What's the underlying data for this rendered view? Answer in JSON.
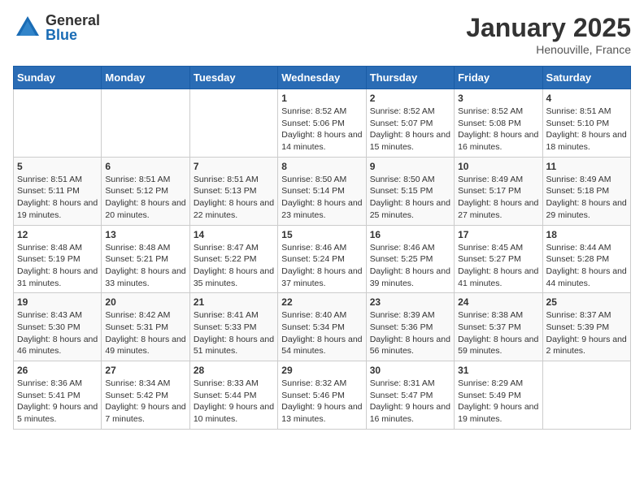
{
  "header": {
    "logo_general": "General",
    "logo_blue": "Blue",
    "month_title": "January 2025",
    "location": "Henouville, France"
  },
  "days_of_week": [
    "Sunday",
    "Monday",
    "Tuesday",
    "Wednesday",
    "Thursday",
    "Friday",
    "Saturday"
  ],
  "weeks": [
    [
      {
        "day": "",
        "info": ""
      },
      {
        "day": "",
        "info": ""
      },
      {
        "day": "",
        "info": ""
      },
      {
        "day": "1",
        "info": "Sunrise: 8:52 AM\nSunset: 5:06 PM\nDaylight: 8 hours\nand 14 minutes."
      },
      {
        "day": "2",
        "info": "Sunrise: 8:52 AM\nSunset: 5:07 PM\nDaylight: 8 hours\nand 15 minutes."
      },
      {
        "day": "3",
        "info": "Sunrise: 8:52 AM\nSunset: 5:08 PM\nDaylight: 8 hours\nand 16 minutes."
      },
      {
        "day": "4",
        "info": "Sunrise: 8:51 AM\nSunset: 5:10 PM\nDaylight: 8 hours\nand 18 minutes."
      }
    ],
    [
      {
        "day": "5",
        "info": "Sunrise: 8:51 AM\nSunset: 5:11 PM\nDaylight: 8 hours\nand 19 minutes."
      },
      {
        "day": "6",
        "info": "Sunrise: 8:51 AM\nSunset: 5:12 PM\nDaylight: 8 hours\nand 20 minutes."
      },
      {
        "day": "7",
        "info": "Sunrise: 8:51 AM\nSunset: 5:13 PM\nDaylight: 8 hours\nand 22 minutes."
      },
      {
        "day": "8",
        "info": "Sunrise: 8:50 AM\nSunset: 5:14 PM\nDaylight: 8 hours\nand 23 minutes."
      },
      {
        "day": "9",
        "info": "Sunrise: 8:50 AM\nSunset: 5:15 PM\nDaylight: 8 hours\nand 25 minutes."
      },
      {
        "day": "10",
        "info": "Sunrise: 8:49 AM\nSunset: 5:17 PM\nDaylight: 8 hours\nand 27 minutes."
      },
      {
        "day": "11",
        "info": "Sunrise: 8:49 AM\nSunset: 5:18 PM\nDaylight: 8 hours\nand 29 minutes."
      }
    ],
    [
      {
        "day": "12",
        "info": "Sunrise: 8:48 AM\nSunset: 5:19 PM\nDaylight: 8 hours\nand 31 minutes."
      },
      {
        "day": "13",
        "info": "Sunrise: 8:48 AM\nSunset: 5:21 PM\nDaylight: 8 hours\nand 33 minutes."
      },
      {
        "day": "14",
        "info": "Sunrise: 8:47 AM\nSunset: 5:22 PM\nDaylight: 8 hours\nand 35 minutes."
      },
      {
        "day": "15",
        "info": "Sunrise: 8:46 AM\nSunset: 5:24 PM\nDaylight: 8 hours\nand 37 minutes."
      },
      {
        "day": "16",
        "info": "Sunrise: 8:46 AM\nSunset: 5:25 PM\nDaylight: 8 hours\nand 39 minutes."
      },
      {
        "day": "17",
        "info": "Sunrise: 8:45 AM\nSunset: 5:27 PM\nDaylight: 8 hours\nand 41 minutes."
      },
      {
        "day": "18",
        "info": "Sunrise: 8:44 AM\nSunset: 5:28 PM\nDaylight: 8 hours\nand 44 minutes."
      }
    ],
    [
      {
        "day": "19",
        "info": "Sunrise: 8:43 AM\nSunset: 5:30 PM\nDaylight: 8 hours\nand 46 minutes."
      },
      {
        "day": "20",
        "info": "Sunrise: 8:42 AM\nSunset: 5:31 PM\nDaylight: 8 hours\nand 49 minutes."
      },
      {
        "day": "21",
        "info": "Sunrise: 8:41 AM\nSunset: 5:33 PM\nDaylight: 8 hours\nand 51 minutes."
      },
      {
        "day": "22",
        "info": "Sunrise: 8:40 AM\nSunset: 5:34 PM\nDaylight: 8 hours\nand 54 minutes."
      },
      {
        "day": "23",
        "info": "Sunrise: 8:39 AM\nSunset: 5:36 PM\nDaylight: 8 hours\nand 56 minutes."
      },
      {
        "day": "24",
        "info": "Sunrise: 8:38 AM\nSunset: 5:37 PM\nDaylight: 8 hours\nand 59 minutes."
      },
      {
        "day": "25",
        "info": "Sunrise: 8:37 AM\nSunset: 5:39 PM\nDaylight: 9 hours\nand 2 minutes."
      }
    ],
    [
      {
        "day": "26",
        "info": "Sunrise: 8:36 AM\nSunset: 5:41 PM\nDaylight: 9 hours\nand 5 minutes."
      },
      {
        "day": "27",
        "info": "Sunrise: 8:34 AM\nSunset: 5:42 PM\nDaylight: 9 hours\nand 7 minutes."
      },
      {
        "day": "28",
        "info": "Sunrise: 8:33 AM\nSunset: 5:44 PM\nDaylight: 9 hours\nand 10 minutes."
      },
      {
        "day": "29",
        "info": "Sunrise: 8:32 AM\nSunset: 5:46 PM\nDaylight: 9 hours\nand 13 minutes."
      },
      {
        "day": "30",
        "info": "Sunrise: 8:31 AM\nSunset: 5:47 PM\nDaylight: 9 hours\nand 16 minutes."
      },
      {
        "day": "31",
        "info": "Sunrise: 8:29 AM\nSunset: 5:49 PM\nDaylight: 9 hours\nand 19 minutes."
      },
      {
        "day": "",
        "info": ""
      }
    ]
  ]
}
